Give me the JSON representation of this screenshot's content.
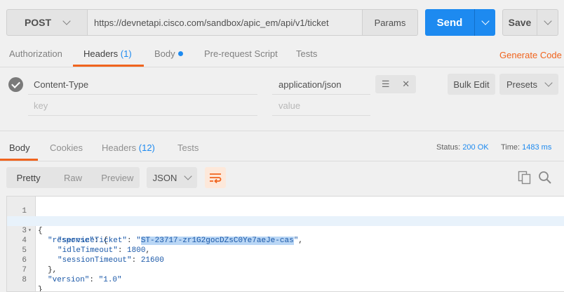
{
  "request": {
    "method": "POST",
    "url": "https://devnetapi.cisco.com/sandbox/apic_em/api/v1/ticket",
    "params_label": "Params",
    "send_label": "Send",
    "save_label": "Save"
  },
  "request_tabs": {
    "authorization": "Authorization",
    "headers": "Headers",
    "headers_count": "(1)",
    "body": "Body",
    "prerequest": "Pre-request Script",
    "tests": "Tests",
    "generate_code": "Generate Code"
  },
  "headers_editor": {
    "key": "Content-Type",
    "value": "application/json",
    "key_placeholder": "key",
    "value_placeholder": "value",
    "bulk_edit": "Bulk Edit",
    "presets": "Presets"
  },
  "response_tabs": {
    "body": "Body",
    "cookies": "Cookies",
    "headers": "Headers",
    "headers_count": "(12)",
    "tests": "Tests"
  },
  "response_meta": {
    "status_label": "Status:",
    "status_value": "200 OK",
    "time_label": "Time:",
    "time_value": "1483 ms"
  },
  "view": {
    "pretty": "Pretty",
    "raw": "Raw",
    "preview": "Preview",
    "format": "JSON"
  },
  "code": {
    "line_numbers": [
      "1",
      "2",
      "3",
      "4",
      "5",
      "6",
      "7",
      "8"
    ],
    "l1": "{",
    "l2_key": "\"response\"",
    "l2_rest": ": {",
    "l3_key": "\"serviceTicket\"",
    "l3_colon": ": ",
    "l3_q1": "\"",
    "l3_sel": "ST-23717-zr1G2gocDZsC0Ye7aeJe-cas",
    "l3_q2": "\"",
    "l3_end": ",",
    "l4_key": "\"idleTimeout\"",
    "l4_colon": ": ",
    "l4_val": "1800",
    "l4_end": ",",
    "l5_key": "\"sessionTimeout\"",
    "l5_colon": ": ",
    "l5_val": "21600",
    "l6": "},",
    "l7_key": "\"version\"",
    "l7_colon": ": ",
    "l7_val": "\"1.0\"",
    "l8": "}"
  },
  "icons": [
    "check-circle-icon",
    "chevron-down-icon",
    "menu-icon",
    "close-icon",
    "wrap-lines-icon",
    "copy-icon",
    "search-icon"
  ],
  "colors": {
    "accent": "#f0641e",
    "primary": "#1d8af0"
  }
}
